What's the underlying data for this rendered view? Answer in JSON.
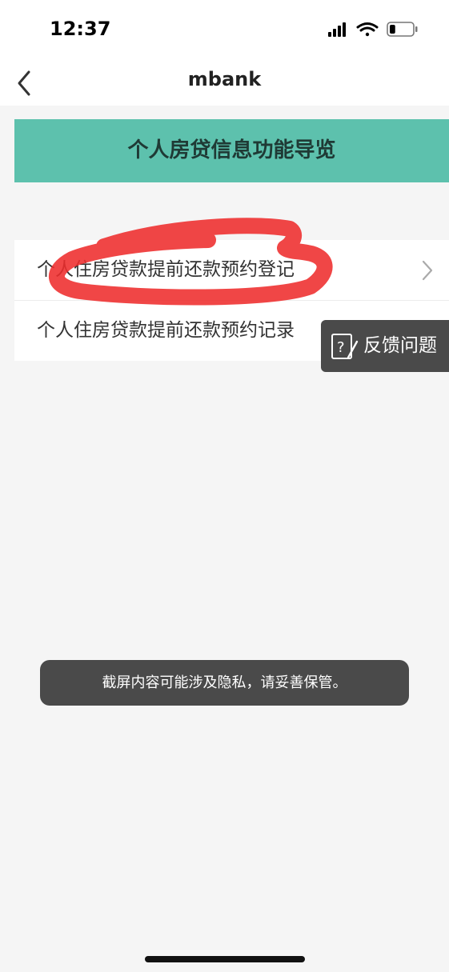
{
  "status_bar": {
    "time": "12:37",
    "battery_level": 0.25
  },
  "nav": {
    "title": "mbank"
  },
  "banner": {
    "title": "个人房贷信息功能导览"
  },
  "menu": {
    "items": [
      {
        "label": "个人住房贷款提前还款预约登记"
      },
      {
        "label": "个人住房贷款提前还款预约记录"
      }
    ]
  },
  "feedback": {
    "label": "反馈问题"
  },
  "toast": {
    "text": "截屏内容可能涉及隐私，请妥善保管。"
  },
  "colors": {
    "banner_bg": "#5dc1ad",
    "annotation_red": "#ee2c2c",
    "overlay_dark": "#4a4a4a"
  }
}
